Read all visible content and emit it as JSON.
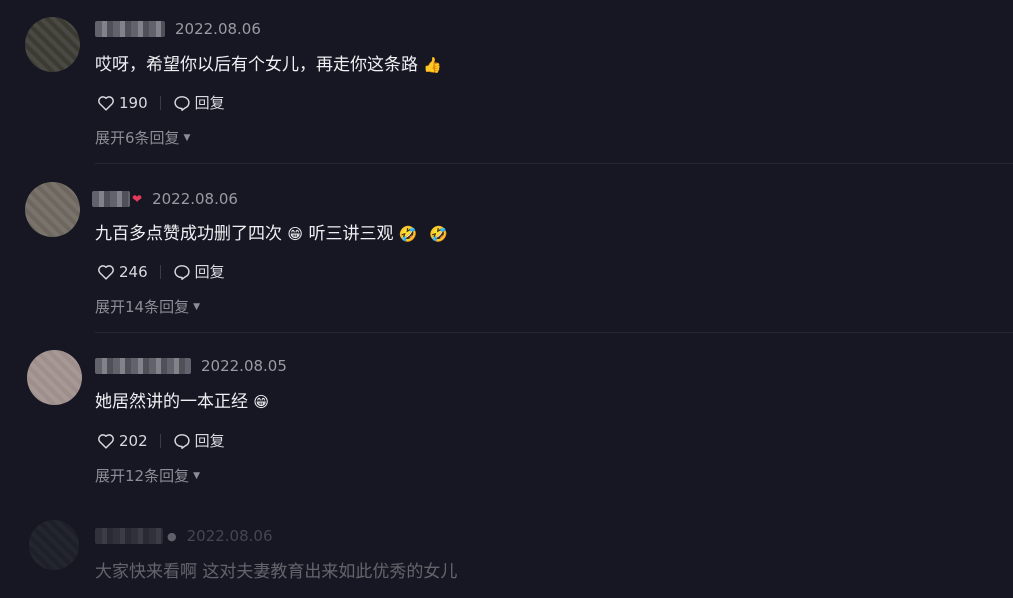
{
  "comments": [
    {
      "date": "2022.08.06",
      "text": "哎呀，希望你以后有个女儿，再走你这条路",
      "emoji": "👍",
      "likes": "190",
      "reply_label": "回复",
      "expand_label": "展开6条回复"
    },
    {
      "date": "2022.08.06",
      "text": "九百多点赞成功删了四次",
      "emoji": "😁",
      "text2": "听三讲三观",
      "emoji2": "🤣",
      "emoji3": "🤣",
      "likes": "246",
      "reply_label": "回复",
      "expand_label": "展开14条回复"
    },
    {
      "date": "2022.08.05",
      "text": "她居然讲的一本正经",
      "emoji": "😁",
      "likes": "202",
      "reply_label": "回复",
      "expand_label": "展开12条回复"
    },
    {
      "date": "2022.08.06",
      "text": "大家快来看啊 这对夫妻教育出来如此优秀的女儿"
    }
  ],
  "icons": {
    "like": "heart-outline",
    "reply": "speech-bubble-outline",
    "expand": "caret-down"
  },
  "colors": {
    "background": "#161722",
    "heart_emoji": "#e8395b"
  }
}
